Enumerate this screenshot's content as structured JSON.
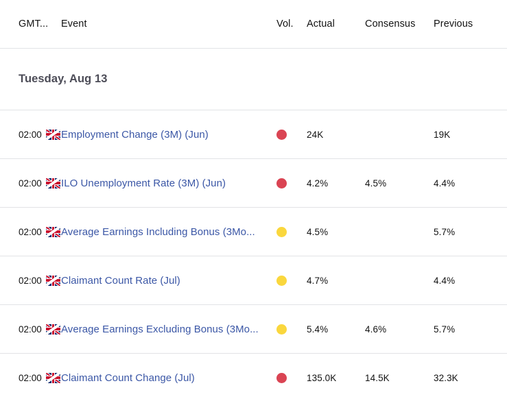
{
  "table": {
    "columns": {
      "time": "GMT...",
      "event": "Event",
      "volatility": "Vol.",
      "actual": "Actual",
      "consensus": "Consensus",
      "previous": "Previous"
    },
    "date_group": "Tuesday, Aug 13",
    "country_flag": "united-kingdom-flag",
    "colors": {
      "high_volatility": "#da4453",
      "medium_volatility": "#fad73d",
      "event_link": "#3b57a6",
      "row_border": "#e2e3e6",
      "date_text": "#4c4c57"
    },
    "rows": [
      {
        "time": "02:00",
        "event": "Employment Change (3M) (Jun)",
        "volatility": "high",
        "actual": "24K",
        "consensus": "",
        "previous": "19K"
      },
      {
        "time": "02:00",
        "event": "ILO Unemployment Rate (3M) (Jun)",
        "volatility": "high",
        "actual": "4.2%",
        "consensus": "4.5%",
        "previous": "4.4%"
      },
      {
        "time": "02:00",
        "event": "Average Earnings Including Bonus (3Mo...",
        "volatility": "medium",
        "actual": "4.5%",
        "consensus": "",
        "previous": "5.7%"
      },
      {
        "time": "02:00",
        "event": "Claimant Count Rate (Jul)",
        "volatility": "medium",
        "actual": "4.7%",
        "consensus": "",
        "previous": "4.4%"
      },
      {
        "time": "02:00",
        "event": "Average Earnings Excluding Bonus (3Mo...",
        "volatility": "medium",
        "actual": "5.4%",
        "consensus": "4.6%",
        "previous": "5.7%"
      },
      {
        "time": "02:00",
        "event": "Claimant Count Change (Jul)",
        "volatility": "high",
        "actual": "135.0K",
        "consensus": "14.5K",
        "previous": "32.3K"
      }
    ]
  }
}
